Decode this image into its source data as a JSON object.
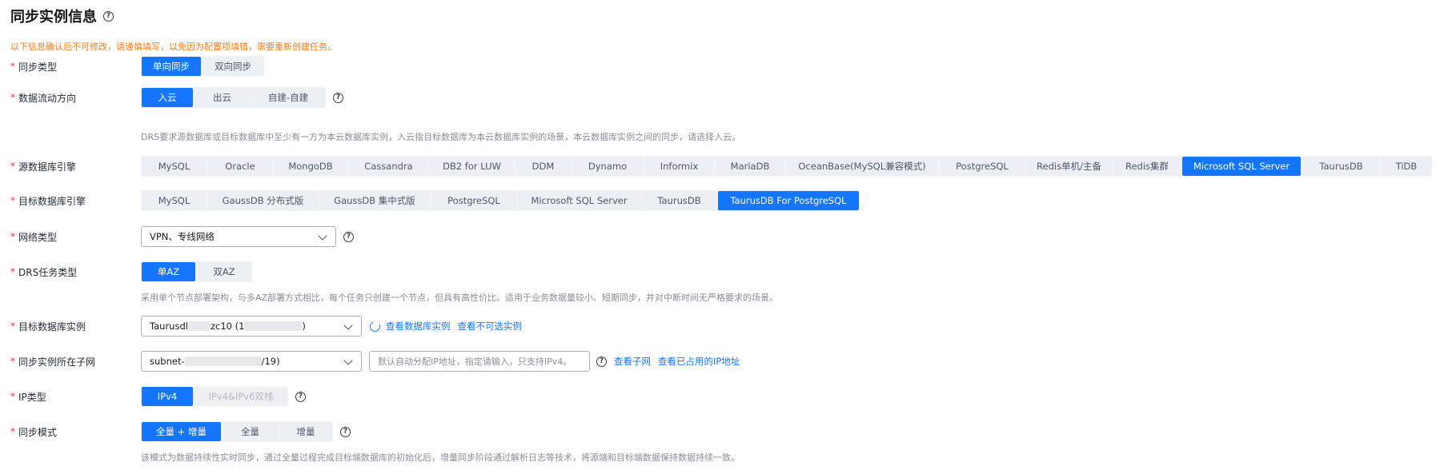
{
  "header": {
    "title": "同步实例信息",
    "warning": "以下信息确认后不可修改，请谨慎填写，以免因为配置项填错，需要重新创建任务。"
  },
  "sync_type": {
    "label": "同步类型",
    "options": [
      "单向同步",
      "双向同步"
    ],
    "selected": "单向同步"
  },
  "flow_direction": {
    "label": "数据流动方向",
    "options": [
      "入云",
      "出云",
      "自建-自建"
    ],
    "selected": "入云",
    "hint": "DRS要求源数据库或目标数据库中至少有一方为本云数据库实例，入云指目标数据库为本云数据库实例的场景，本云数据库实例之间的同步，请选择入云。"
  },
  "source_engine": {
    "label": "源数据库引擎",
    "options": [
      "MySQL",
      "Oracle",
      "MongoDB",
      "Cassandra",
      "DB2 for LUW",
      "DDM",
      "Dynamo",
      "Informix",
      "MariaDB",
      "OceanBase(MySQL兼容模式)",
      "PostgreSQL",
      "Redis单机/主备",
      "Redis集群",
      "Microsoft SQL Server",
      "TaurusDB",
      "TiDB"
    ],
    "selected": "Microsoft SQL Server"
  },
  "target_engine": {
    "label": "目标数据库引擎",
    "options": [
      "MySQL",
      "GaussDB 分布式版",
      "GaussDB 集中式版",
      "PostgreSQL",
      "Microsoft SQL Server",
      "TaurusDB",
      "TaurusDB For PostgreSQL"
    ],
    "selected": "TaurusDB For PostgreSQL"
  },
  "network_type": {
    "label": "网络类型",
    "value": "VPN、专线网络"
  },
  "task_type": {
    "label": "DRS任务类型",
    "options": [
      "单AZ",
      "双AZ"
    ],
    "selected": "单AZ",
    "hint": "采用单个节点部署架构，与多AZ部署方式相比，每个任务只创建一个节点，但具有高性价比。适用于业务数据量较小、短期同步，并对中断时间无严格要求的场景。"
  },
  "target_instance": {
    "label": "目标数据库实例",
    "value_prefix": "Taurusdl",
    "value_mid": "zc10 (1",
    "value_suffix": ")",
    "links": [
      "查看数据库实例",
      "查看不可选实例"
    ]
  },
  "subnet": {
    "label": "同步实例所在子网",
    "value_prefix": "subnet-",
    "value_suffix": "/19)",
    "ip_placeholder": "默认自动分配IP地址，指定请输入，只支持IPv4。",
    "links": [
      "查看子网",
      "查看已占用的IP地址"
    ]
  },
  "ip_type": {
    "label": "IP类型",
    "options": [
      "IPv4",
      "IPv4&IPv6双栈"
    ],
    "selected": "IPv4",
    "disabled": [
      "IPv4&IPv6双栈"
    ]
  },
  "sync_mode": {
    "label": "同步模式",
    "options": [
      "全量 + 增量",
      "全量",
      "增量"
    ],
    "selected": "全量 + 增量",
    "hint": "该模式为数据持续性实时同步，通过全量过程完成目标端数据库的初始化后，增量同步阶段通过解析日志等技术，将源端和目标端数据保持数据持续一致。"
  },
  "icons": {
    "help": "question-circle-icon",
    "dropdown": "chevron-down-icon",
    "refresh": "refresh-icon"
  },
  "colors": {
    "primary": "#1476ff",
    "required": "#e8343c",
    "warning": "#fa7d1e"
  }
}
